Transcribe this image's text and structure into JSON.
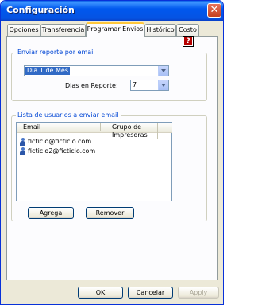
{
  "window": {
    "title": "Configuración",
    "close_glyph": "✕"
  },
  "tabs": [
    {
      "label": "Opciones"
    },
    {
      "label": "Transferencia"
    },
    {
      "label": "Programar Envios"
    },
    {
      "label": "Histórico"
    },
    {
      "label": "Costo"
    }
  ],
  "active_tab": "Programar Envios",
  "help": {
    "icon": "help-icon",
    "glyph": "?"
  },
  "report_group": {
    "title": "Enviar reporte por email",
    "schedule_value": "Dia 1 de Mes",
    "days_label": "Dias en Reporte:",
    "days_value": "7"
  },
  "users_group": {
    "title": "Lista de usuarios a enviar email",
    "columns": [
      "Email",
      "Grupo de Impresoras"
    ],
    "rows": [
      {
        "email": "ficticio@ficticio.com",
        "group": "",
        "icon": "user-icon"
      },
      {
        "email": "ficticio2@ficticio.com",
        "group": "",
        "icon": "user-icon"
      }
    ],
    "add_label": "Agrega",
    "remove_label": "Remover"
  },
  "footer": {
    "ok_label": "OK",
    "cancel_label": "Cancelar",
    "apply_label": "Apply"
  },
  "colors": {
    "title_bar": "#0058ee",
    "group_title": "#0046d5",
    "selection": "#316ac5",
    "face": "#ece9d8"
  }
}
